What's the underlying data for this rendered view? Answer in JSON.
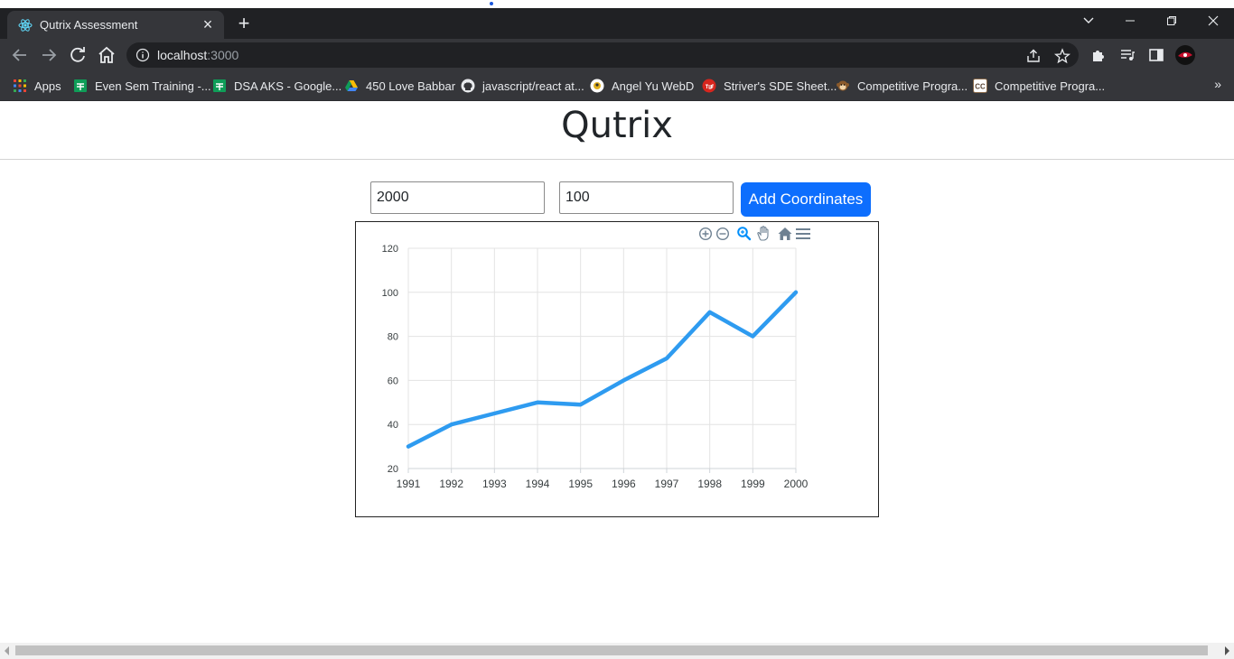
{
  "browser": {
    "tab_title": "Qutrix Assessment",
    "url_host": "localhost",
    "url_port": ":3000",
    "bookmarks": [
      {
        "label": "Apps",
        "icon": "apps-grid-icon"
      },
      {
        "label": "Even Sem Training -...",
        "icon": "sheets-icon"
      },
      {
        "label": "DSA AKS - Google...",
        "icon": "sheets-icon"
      },
      {
        "label": "450 Love Babbar",
        "icon": "drive-icon"
      },
      {
        "label": "javascript/react at...",
        "icon": "github-icon"
      },
      {
        "label": "Angel Yu WebD",
        "icon": "notion-icon"
      },
      {
        "label": "Striver's SDE Sheet...",
        "icon": "tuf-icon"
      },
      {
        "label": "Competitive Progra...",
        "icon": "monkey-icon"
      },
      {
        "label": "Competitive Progra...",
        "icon": "codechef-icon"
      }
    ],
    "bookmarks_more": "»"
  },
  "page": {
    "heading": "Qutrix",
    "x_input_value": "2000",
    "y_input_value": "100",
    "add_button_label": "Add Coordinates"
  },
  "chart_data": {
    "type": "line",
    "x": [
      1991,
      1992,
      1993,
      1994,
      1995,
      1996,
      1997,
      1998,
      1999,
      2000
    ],
    "series": [
      {
        "values": [
          30,
          40,
          45,
          50,
          49,
          60,
          70,
          91,
          80,
          100
        ],
        "color": "#2e9bf0"
      }
    ],
    "ylim": [
      20,
      120
    ],
    "yticks": [
      20,
      40,
      60,
      80,
      100,
      120
    ],
    "grid": true,
    "toolbar_icons": [
      "zoom-in-icon",
      "zoom-out-icon",
      "selection-zoom-icon",
      "pan-hand-icon",
      "reset-home-icon",
      "menu-icon"
    ]
  }
}
